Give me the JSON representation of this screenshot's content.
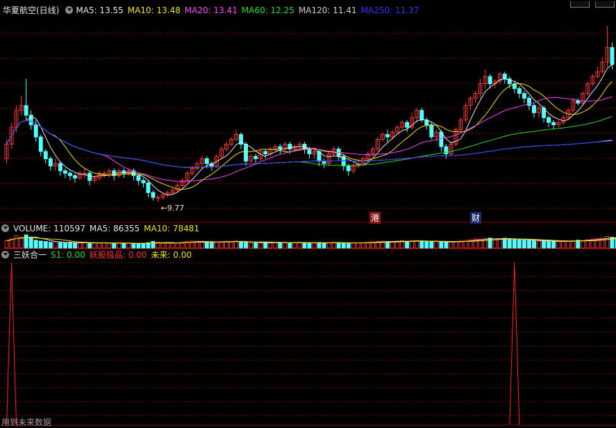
{
  "main_panel": {
    "title": "华夏航空(日线)",
    "indicators": [
      {
        "label": "MA5: 13.55",
        "color": "#e8e8e8"
      },
      {
        "label": "MA10: 13.48",
        "color": "#f2e600"
      },
      {
        "label": "MA20: 13.41",
        "color": "#ff40ff"
      },
      {
        "label": "MA60: 12.25",
        "color": "#22dd22"
      },
      {
        "label": "MA120: 11.41",
        "color": "#d0d0d0"
      },
      {
        "label": "MA250: 11.37",
        "color": "#3333ff"
      }
    ],
    "low_label": "9.77",
    "markers": [
      {
        "text": "港",
        "bg": "#8a1a1a"
      },
      {
        "text": "财",
        "bg": "#1a2a6a"
      }
    ]
  },
  "volume_panel": {
    "indicators": [
      {
        "label": "VOLUME: 110597",
        "color": "#e8e8e8"
      },
      {
        "label": "MA5: 86355",
        "color": "#e8e8e8"
      },
      {
        "label": "MA10: 78481",
        "color": "#f2e600"
      }
    ]
  },
  "sub_panel": {
    "name": "三妖合一",
    "indicators": [
      {
        "label": "S1: 0.00",
        "color": "#22dd22"
      },
      {
        "label": "妖股极品: 0.00",
        "color": "#ff3030"
      },
      {
        "label": "未来: 0.00",
        "color": "#f2e600"
      }
    ]
  },
  "footer": {
    "text": "用到未来数据"
  },
  "colors": {
    "up": "#ff3232",
    "down": "#54ffff",
    "grid": "#8b0000",
    "signal": "#ff2020"
  },
  "chart_data": [
    {
      "type": "candlestick",
      "title": "华夏航空(日线)",
      "ylim": [
        9.3,
        17.2
      ],
      "x": [
        1,
        2,
        3,
        4,
        5,
        6,
        7,
        8,
        9,
        10,
        11,
        12,
        13,
        14,
        15,
        16,
        17,
        18,
        19,
        20,
        21,
        22,
        23,
        24,
        25,
        26,
        27,
        28,
        29,
        30,
        31,
        32,
        33,
        34,
        35,
        36,
        37,
        38,
        39,
        40,
        41,
        42,
        43,
        44,
        45,
        46,
        47,
        48,
        49,
        50,
        51,
        52,
        53,
        54,
        55,
        56,
        57,
        58,
        59,
        60,
        61,
        62,
        63,
        64,
        65,
        66,
        67,
        68,
        69,
        70,
        71,
        72,
        73,
        74,
        75,
        76,
        77,
        78,
        79,
        80,
        81,
        82,
        83,
        84,
        85,
        86,
        87,
        88,
        89,
        90,
        91,
        92,
        93,
        94,
        95,
        96,
        97,
        98,
        99,
        100,
        101,
        102,
        103,
        104,
        105,
        106,
        107,
        108,
        109,
        110,
        111,
        112,
        113,
        114,
        115,
        116,
        117,
        118,
        119,
        120,
        121,
        122,
        123,
        124,
        125,
        126,
        127,
        128
      ],
      "open": [
        11.5,
        12.1,
        12.8,
        13.5,
        13.7,
        13.3,
        12.9,
        12.4,
        11.8,
        11.5,
        11.2,
        11.3,
        11.0,
        10.9,
        10.8,
        10.7,
        10.9,
        10.9,
        10.6,
        10.7,
        10.9,
        10.9,
        11.0,
        10.8,
        11.0,
        10.9,
        11.0,
        10.8,
        10.6,
        10.5,
        10.1,
        9.9,
        9.9,
        10.0,
        10.1,
        10.2,
        10.4,
        10.6,
        10.9,
        11.1,
        11.3,
        11.5,
        11.3,
        11.2,
        11.6,
        11.9,
        12.1,
        12.3,
        12.5,
        12.1,
        11.4,
        11.6,
        11.5,
        11.8,
        11.7,
        11.9,
        12.0,
        11.9,
        12.1,
        11.9,
        12.0,
        12.1,
        11.9,
        11.7,
        11.8,
        11.4,
        11.3,
        11.7,
        11.9,
        11.6,
        11.2,
        11.0,
        11.2,
        11.3,
        11.5,
        11.7,
        11.9,
        12.3,
        12.5,
        12.4,
        12.6,
        12.8,
        13.0,
        12.8,
        13.2,
        13.5,
        13.1,
        12.9,
        12.4,
        12.6,
        12.0,
        11.7,
        12.1,
        12.7,
        13.1,
        13.7,
        14.0,
        14.2,
        14.6,
        14.9,
        14.6,
        14.7,
        15.0,
        14.8,
        14.6,
        14.4,
        14.2,
        14.0,
        13.7,
        13.4,
        13.6,
        13.2,
        13.0,
        12.9,
        13.0,
        13.2,
        13.5,
        13.9,
        13.8,
        14.2,
        14.6,
        14.9,
        15.1,
        15.5,
        16.1
      ],
      "close": [
        12.1,
        12.8,
        13.5,
        13.7,
        13.3,
        12.9,
        12.4,
        11.8,
        11.5,
        11.2,
        11.3,
        11.0,
        10.9,
        10.8,
        10.7,
        10.9,
        10.9,
        10.6,
        10.7,
        10.9,
        10.9,
        11.0,
        10.8,
        11.0,
        10.9,
        11.0,
        10.8,
        10.6,
        10.5,
        10.1,
        9.9,
        9.9,
        10.0,
        10.1,
        10.2,
        10.4,
        10.6,
        10.9,
        11.1,
        11.3,
        11.5,
        11.3,
        11.2,
        11.6,
        11.9,
        12.1,
        12.3,
        12.5,
        12.1,
        11.4,
        11.6,
        11.5,
        11.8,
        11.7,
        11.9,
        12.0,
        11.9,
        12.1,
        11.9,
        12.0,
        12.1,
        11.9,
        11.7,
        11.8,
        11.4,
        11.3,
        11.7,
        11.9,
        11.6,
        11.2,
        11.0,
        11.2,
        11.3,
        11.5,
        11.7,
        11.9,
        12.3,
        12.5,
        12.4,
        12.6,
        12.8,
        13.0,
        12.8,
        13.2,
        13.5,
        13.1,
        12.9,
        12.4,
        12.6,
        12.0,
        11.7,
        12.1,
        12.7,
        13.1,
        13.7,
        14.0,
        14.2,
        14.6,
        14.9,
        14.6,
        14.7,
        15.0,
        14.8,
        14.6,
        14.4,
        14.2,
        14.0,
        13.7,
        13.4,
        13.6,
        13.2,
        13.0,
        12.9,
        13.0,
        13.2,
        13.5,
        13.9,
        13.8,
        14.2,
        14.6,
        14.9,
        15.1,
        15.5,
        16.1,
        15.4
      ],
      "high": [
        12.3,
        13.0,
        13.7,
        14.1,
        14.8,
        13.5,
        13.1,
        12.5,
        11.9,
        11.6,
        11.5,
        11.4,
        11.1,
        11.0,
        10.9,
        11.0,
        11.1,
        11.0,
        10.8,
        11.0,
        11.0,
        11.1,
        11.1,
        11.1,
        11.1,
        11.1,
        11.1,
        10.9,
        10.7,
        10.6,
        10.2,
        10.0,
        10.1,
        10.2,
        10.3,
        10.5,
        10.7,
        11.0,
        11.2,
        11.4,
        11.6,
        11.6,
        11.4,
        11.7,
        12.0,
        12.2,
        12.4,
        12.7,
        12.6,
        12.2,
        11.7,
        11.7,
        11.9,
        11.9,
        12.0,
        12.1,
        12.1,
        12.2,
        12.2,
        12.1,
        12.2,
        12.2,
        12.0,
        11.9,
        11.9,
        11.5,
        11.8,
        12.0,
        12.0,
        11.7,
        11.3,
        11.3,
        11.4,
        11.6,
        11.8,
        12.0,
        12.4,
        12.6,
        12.7,
        12.7,
        12.9,
        13.1,
        13.1,
        13.4,
        13.6,
        13.6,
        13.2,
        13.0,
        12.7,
        12.7,
        12.1,
        12.2,
        12.8,
        13.2,
        13.8,
        14.1,
        14.3,
        14.8,
        15.2,
        15.0,
        14.8,
        15.1,
        15.1,
        14.9,
        14.7,
        14.5,
        14.3,
        14.1,
        13.8,
        13.7,
        13.7,
        13.3,
        13.1,
        13.1,
        13.3,
        13.6,
        14.0,
        14.0,
        14.3,
        14.7,
        15.0,
        15.3,
        15.7,
        17.0,
        16.3
      ],
      "low": [
        11.3,
        11.9,
        12.6,
        13.3,
        13.1,
        12.7,
        12.2,
        11.6,
        11.3,
        11.0,
        11.0,
        10.8,
        10.7,
        10.6,
        10.5,
        10.6,
        10.7,
        10.4,
        10.5,
        10.6,
        10.7,
        10.7,
        10.6,
        10.7,
        10.7,
        10.8,
        10.6,
        10.4,
        10.3,
        9.9,
        9.77,
        9.7,
        9.8,
        9.9,
        10.0,
        10.1,
        10.3,
        10.5,
        10.8,
        11.0,
        11.1,
        11.1,
        11.0,
        11.1,
        11.5,
        11.8,
        12.0,
        12.2,
        11.9,
        11.2,
        11.2,
        11.3,
        11.4,
        11.5,
        11.6,
        11.8,
        11.7,
        11.8,
        11.7,
        11.8,
        11.9,
        11.7,
        11.5,
        11.5,
        11.2,
        11.1,
        11.2,
        11.6,
        11.4,
        11.0,
        10.8,
        10.9,
        11.1,
        11.2,
        11.4,
        11.6,
        11.8,
        12.2,
        12.2,
        12.3,
        12.5,
        12.7,
        12.6,
        12.7,
        13.0,
        13.0,
        12.7,
        12.3,
        12.2,
        11.8,
        11.5,
        11.6,
        12.0,
        12.6,
        13.0,
        13.5,
        13.8,
        14.0,
        14.4,
        14.4,
        14.4,
        14.6,
        14.6,
        14.4,
        14.2,
        14.0,
        13.8,
        13.5,
        13.2,
        13.2,
        13.0,
        12.8,
        12.7,
        12.8,
        12.9,
        13.1,
        13.4,
        13.7,
        13.7,
        14.1,
        14.5,
        14.8,
        15.0,
        15.3,
        15.2
      ]
    },
    {
      "type": "bar",
      "title": "VOLUME",
      "values_note": "relative",
      "values": [
        90,
        110,
        150,
        130,
        160,
        120,
        95,
        85,
        80,
        70,
        75,
        65,
        60,
        70,
        60,
        65,
        70,
        55,
        60,
        60,
        65,
        60,
        55,
        62,
        58,
        60,
        55,
        50,
        52,
        65,
        80,
        70,
        60,
        62,
        58,
        62,
        70,
        80,
        85,
        82,
        78,
        72,
        65,
        70,
        78,
        82,
        80,
        85,
        78,
        70,
        62,
        66,
        64,
        68,
        62,
        66,
        68,
        70,
        64,
        66,
        70,
        64,
        58,
        62,
        66,
        60,
        64,
        68,
        66,
        62,
        58,
        60,
        64,
        66,
        70,
        74,
        80,
        82,
        78,
        80,
        84,
        88,
        82,
        86,
        90,
        86,
        80,
        76,
        78,
        74,
        70,
        74,
        80,
        86,
        92,
        100,
        110,
        105,
        115,
        120,
        110,
        112,
        118,
        110,
        104,
        100,
        96,
        92,
        88,
        86,
        90,
        84,
        80,
        78,
        80,
        84,
        90,
        96,
        92,
        100,
        108,
        114,
        120,
        140,
        130,
        125,
        115,
        110
      ]
    },
    {
      "type": "line",
      "title": "三妖合一",
      "values": [
        0,
        1,
        0,
        0,
        0,
        0,
        0,
        0,
        0,
        0,
        0,
        0,
        0,
        0,
        0,
        0,
        0,
        0,
        0,
        0,
        0,
        0,
        0,
        0,
        0,
        0,
        0,
        0,
        0,
        0,
        0,
        0,
        0,
        0,
        0,
        0,
        0,
        0,
        0,
        0,
        0,
        0,
        0,
        0,
        0,
        0,
        0,
        0,
        0,
        0,
        0,
        0,
        0,
        0,
        0,
        0,
        0,
        0,
        0,
        0,
        0,
        0,
        0,
        0,
        0,
        0,
        0,
        0,
        0,
        0,
        0,
        0,
        0,
        0,
        0,
        0,
        0,
        0,
        0,
        0,
        0,
        0,
        0,
        0,
        0,
        0,
        0,
        0,
        0,
        0,
        0,
        0,
        0,
        0,
        0,
        0,
        0,
        0,
        0,
        0,
        0,
        0,
        0,
        0,
        1,
        0,
        0,
        0,
        0,
        0,
        0,
        0,
        0,
        0,
        0,
        0,
        0,
        0,
        0,
        0,
        0,
        0,
        0,
        0,
        0,
        0,
        0,
        0
      ]
    }
  ]
}
